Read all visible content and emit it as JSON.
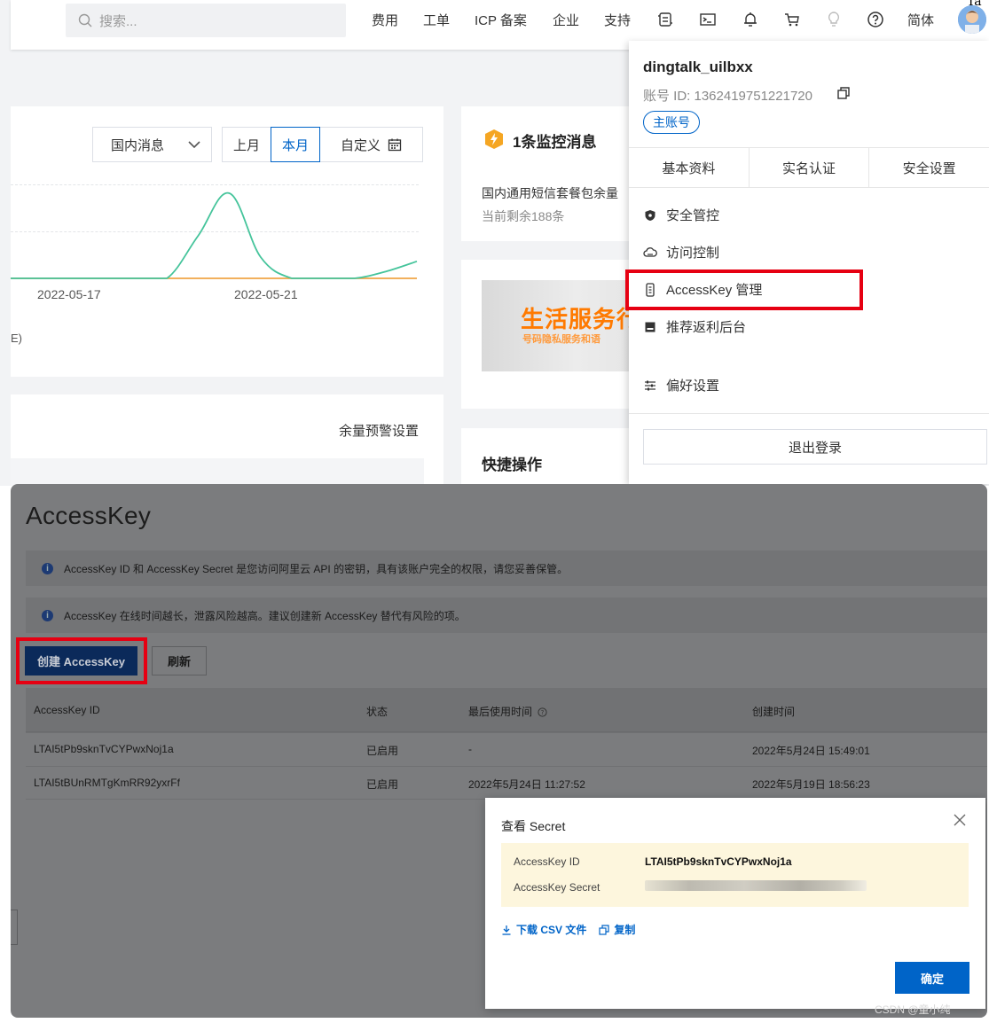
{
  "topbar": {
    "search_placeholder": "搜索...",
    "nav": [
      "费用",
      "工单",
      "ICP 备案",
      "企业",
      "支持"
    ],
    "lang": "简体",
    "corner_text": "Ta"
  },
  "chart_card": {
    "type_select": "国内消息",
    "segments": [
      "上月",
      "本月",
      "自定义"
    ],
    "active_segment": "本月",
    "legend_fragment": "E)"
  },
  "chart_data": {
    "type": "line",
    "x_ticks": [
      "2022-05-17",
      "2022-05-21"
    ],
    "series": [
      {
        "color": "#45c49b",
        "values": [
          0,
          0,
          0,
          0,
          0,
          0,
          0.5,
          1.0,
          0.25,
          0,
          0,
          0,
          0.08,
          0.2
        ]
      },
      {
        "color": "#f0a446",
        "values": [
          0,
          0,
          0,
          0,
          0,
          0,
          0,
          0,
          0,
          0,
          0,
          0,
          0,
          0
        ]
      }
    ]
  },
  "balance_card": {
    "link": "余量预警设置"
  },
  "monitor_card": {
    "title": "1条监控消息",
    "line1": "国内通用短信套餐包余量",
    "line2": "当前剩余188条"
  },
  "banner": {
    "title": "生活服务行",
    "subtitle": "号码隐私服务和语"
  },
  "quick_card": {
    "title": "快捷操作"
  },
  "account": {
    "username": "dingtalk_uilbxx",
    "id_label": "账号 ID: 1362419751221720",
    "badge": "主账号",
    "tabs": [
      "基本资料",
      "实名认证",
      "安全设置"
    ],
    "menu": [
      {
        "label": "安全管控",
        "icon": "shield-icon"
      },
      {
        "label": "访问控制",
        "icon": "cloud-icon"
      },
      {
        "label": "AccessKey 管理",
        "icon": "key-icon"
      },
      {
        "label": "推荐返利后台",
        "icon": "gift-icon"
      },
      {
        "label": "偏好设置",
        "icon": "sliders-icon"
      }
    ],
    "logout": "退出登录"
  },
  "accesskey_page": {
    "title": "AccessKey",
    "notices": [
      "AccessKey ID 和 AccessKey Secret 是您访问阿里云 API 的密钥，具有该账户完全的权限，请您妥善保管。",
      "AccessKey 在线时间越长，泄露风险越高。建议创建新 AccessKey 替代有风险的项。"
    ],
    "create_button": "创建 AccessKey",
    "refresh_button": "刷新",
    "columns": [
      "AccessKey ID",
      "状态",
      "最后使用时间",
      "创建时间"
    ],
    "rows": [
      [
        "LTAI5tPb9sknTvCYPwxNoj1a",
        "已启用",
        "-",
        "2022年5月24日 15:49:01"
      ],
      [
        "LTAI5tBUnRMTgKmRR92yxrFf",
        "已启用",
        "2022年5月24日 11:27:52",
        "2022年5月19日 18:56:23"
      ]
    ]
  },
  "secret_dialog": {
    "title": "查看 Secret",
    "id_label": "AccessKey ID",
    "id_value": "LTAI5tPb9sknTvCYPwxNoj1a",
    "secret_label": "AccessKey Secret",
    "download": "下载 CSV 文件",
    "copy": "复制",
    "ok": "确定"
  },
  "watermark": "CSDN @童小纯"
}
